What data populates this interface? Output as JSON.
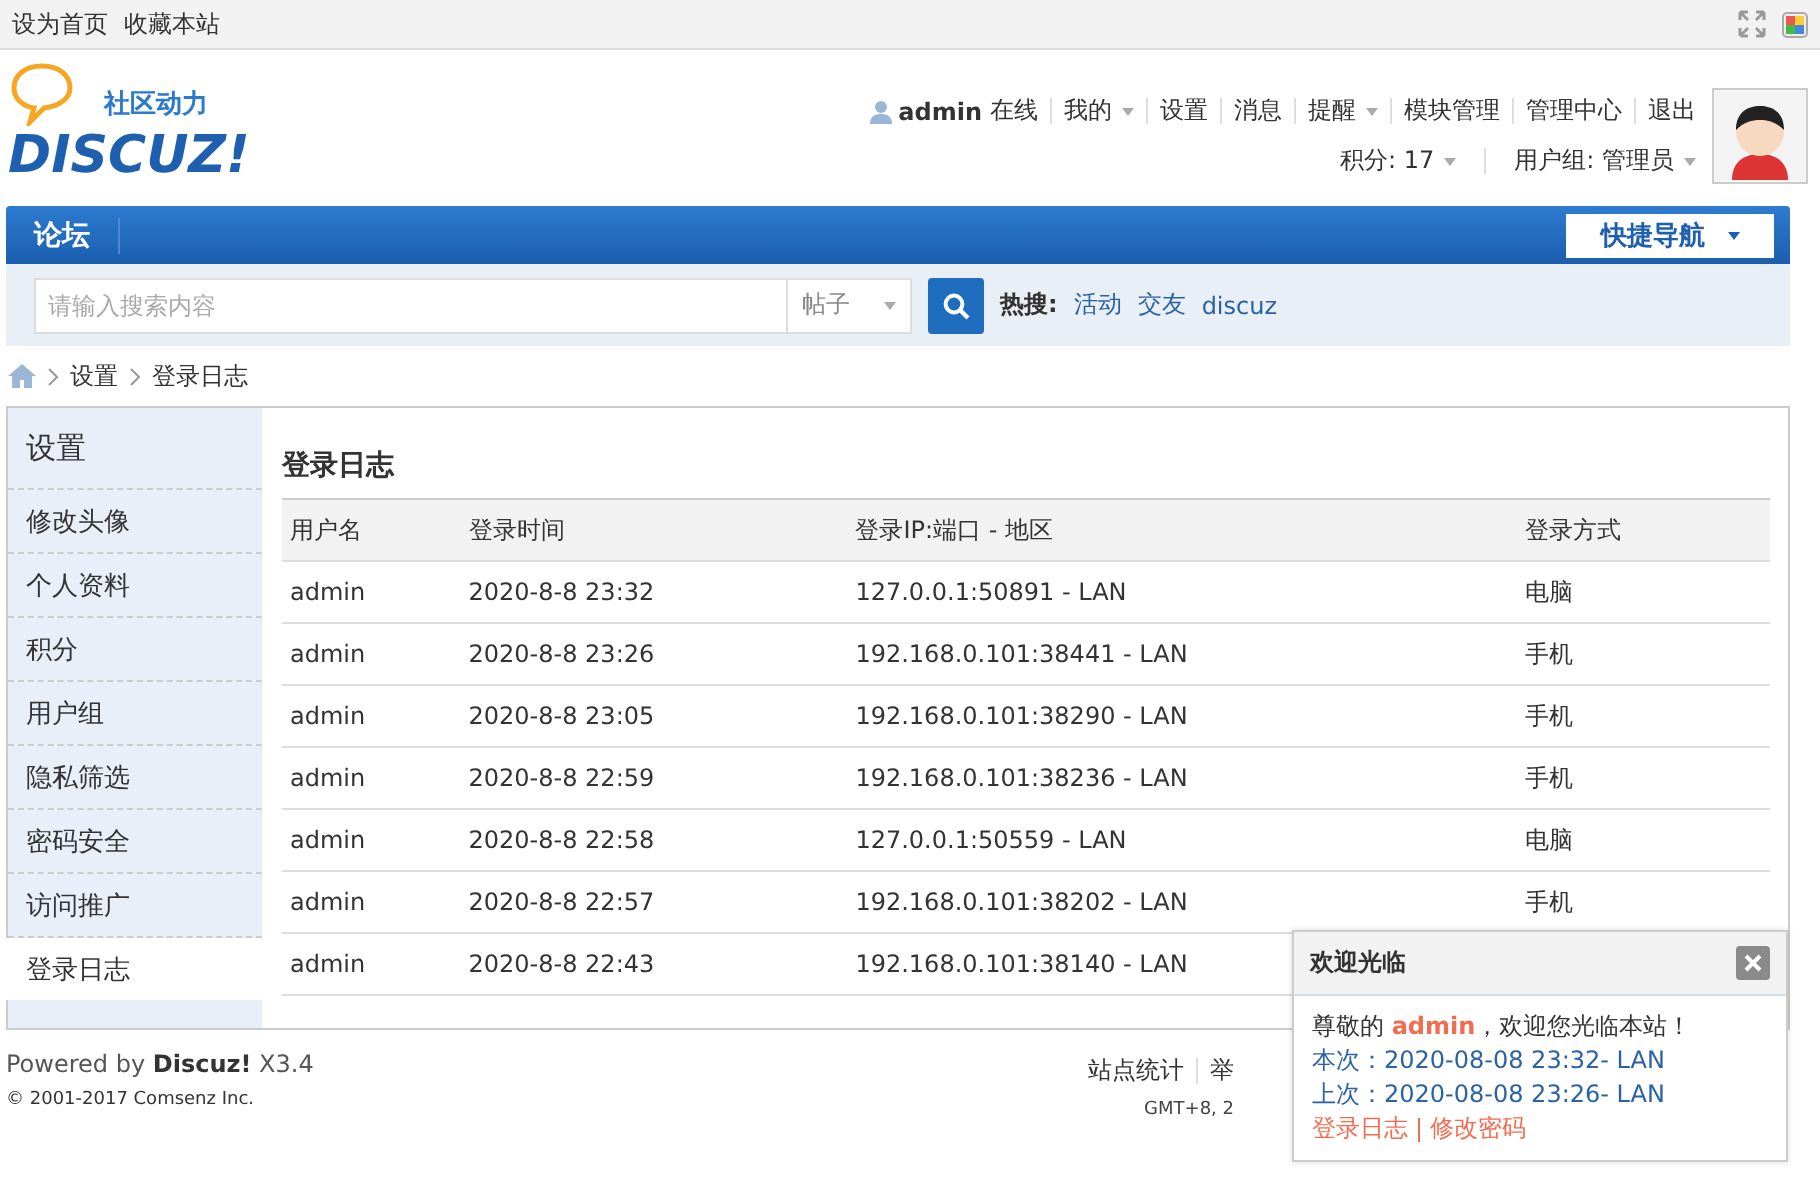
{
  "top_bar": {
    "links": [
      "设为首页",
      "收藏本站"
    ]
  },
  "header": {
    "logo_text": "DISCUZ!",
    "logo_tagline": "社区动力",
    "user": {
      "name": "admin",
      "status": "在线"
    },
    "menu": [
      {
        "label": "我的",
        "dropdown": true
      },
      {
        "label": "设置",
        "dropdown": false
      },
      {
        "label": "消息",
        "dropdown": false
      },
      {
        "label": "提醒",
        "dropdown": true
      },
      {
        "label": "模块管理",
        "dropdown": false
      },
      {
        "label": "管理中心",
        "dropdown": false
      },
      {
        "label": "退出",
        "dropdown": false
      }
    ],
    "stats": [
      {
        "label": "积分: 17",
        "dropdown": true
      },
      {
        "label": "用户组: 管理员",
        "dropdown": true
      }
    ]
  },
  "nav": {
    "items": [
      {
        "label": "论坛",
        "selected": true
      }
    ],
    "quick_nav": "快捷导航"
  },
  "search": {
    "placeholder": "请输入搜索内容",
    "type": "帖子",
    "hot_label": "热搜:",
    "hot_terms": [
      "活动",
      "交友",
      "discuz"
    ]
  },
  "breadcrumb": [
    "设置",
    "登录日志"
  ],
  "sidebar": {
    "title": "设置",
    "items": [
      {
        "label": "修改头像",
        "selected": false
      },
      {
        "label": "个人资料",
        "selected": false
      },
      {
        "label": "积分",
        "selected": false
      },
      {
        "label": "用户组",
        "selected": false
      },
      {
        "label": "隐私筛选",
        "selected": false
      },
      {
        "label": "密码安全",
        "selected": false
      },
      {
        "label": "访问推广",
        "selected": false
      },
      {
        "label": "登录日志",
        "selected": true
      }
    ]
  },
  "content": {
    "title": "登录日志",
    "table": {
      "columns": [
        "用户名",
        "登录时间",
        "登录IP:端口 - 地区",
        "登录方式"
      ],
      "rows": [
        {
          "user": "admin",
          "time": "2020-8-8 23:32",
          "ip": "127.0.0.1:50891 - LAN",
          "method": "电脑"
        },
        {
          "user": "admin",
          "time": "2020-8-8 23:26",
          "ip": "192.168.0.101:38441 - LAN",
          "method": "手机"
        },
        {
          "user": "admin",
          "time": "2020-8-8 23:05",
          "ip": "192.168.0.101:38290 - LAN",
          "method": "手机"
        },
        {
          "user": "admin",
          "time": "2020-8-8 22:59",
          "ip": "192.168.0.101:38236 - LAN",
          "method": "手机"
        },
        {
          "user": "admin",
          "time": "2020-8-8 22:58",
          "ip": "127.0.0.1:50559 - LAN",
          "method": "电脑"
        },
        {
          "user": "admin",
          "time": "2020-8-8 22:57",
          "ip": "192.168.0.101:38202 - LAN",
          "method": "手机"
        },
        {
          "user": "admin",
          "time": "2020-8-8 22:43",
          "ip": "192.168.0.101:38140 - LAN"
        }
      ]
    }
  },
  "footer": {
    "powered": "Powered by **Discuz!** X3.4",
    "copyright": "© 2001-2017 Comsenz Inc.",
    "links": [
      "站点统计",
      "举"
    ],
    "timezone": "GMT+8, 2"
  },
  "popup": {
    "title": "欢迎光临",
    "greeting_prefix": "尊敬的",
    "greeting_name": "admin",
    "greeting_suffix": "，欢迎您光临本站！",
    "this_visit": "本次：2020-08-08 23:32- LAN",
    "last_visit": "上次：2020-08-08 23:26- LAN",
    "links": [
      "登录日志",
      "修改密码"
    ]
  }
}
